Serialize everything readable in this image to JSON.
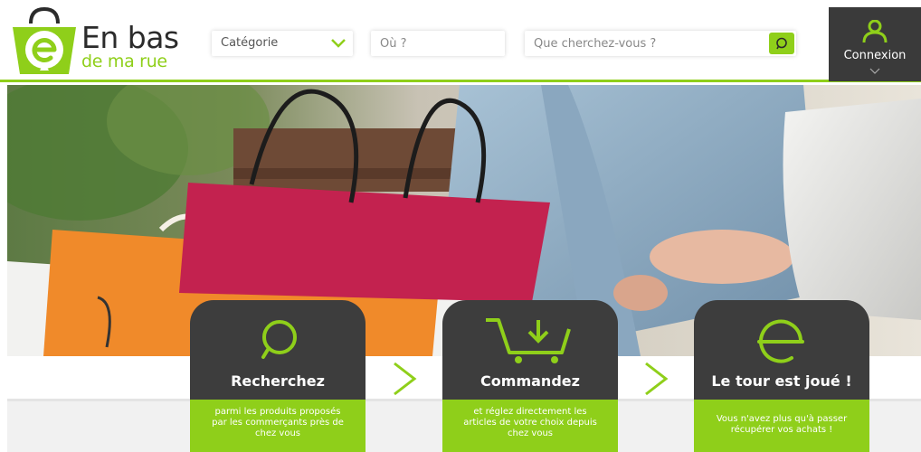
{
  "logo": {
    "title": "En bas",
    "subtitle": "de ma rue"
  },
  "search": {
    "category_label": "Catégorie",
    "where_placeholder": "Où ?",
    "what_placeholder": "Que cherchez-vous ?"
  },
  "account": {
    "label": "Connexion"
  },
  "colors": {
    "accent": "#8fcf1a",
    "dark": "#3d3d3d",
    "band": "#f1f1f1"
  },
  "steps": [
    {
      "icon": "speech-bubble-icon",
      "title": "Recherchez",
      "lines": [
        "parmi les produits proposés",
        "par les commerçants près de",
        "chez vous"
      ]
    },
    {
      "icon": "cart-icon",
      "title": "Commandez",
      "lines": [
        "et réglez directement les",
        "articles de votre choix depuis",
        "chez vous"
      ]
    },
    {
      "icon": "logo-e-icon",
      "title": "Le tour est joué !",
      "lines": [
        "Vous n'avez plus qu'à passer",
        "récupérer vos achats !"
      ]
    }
  ]
}
